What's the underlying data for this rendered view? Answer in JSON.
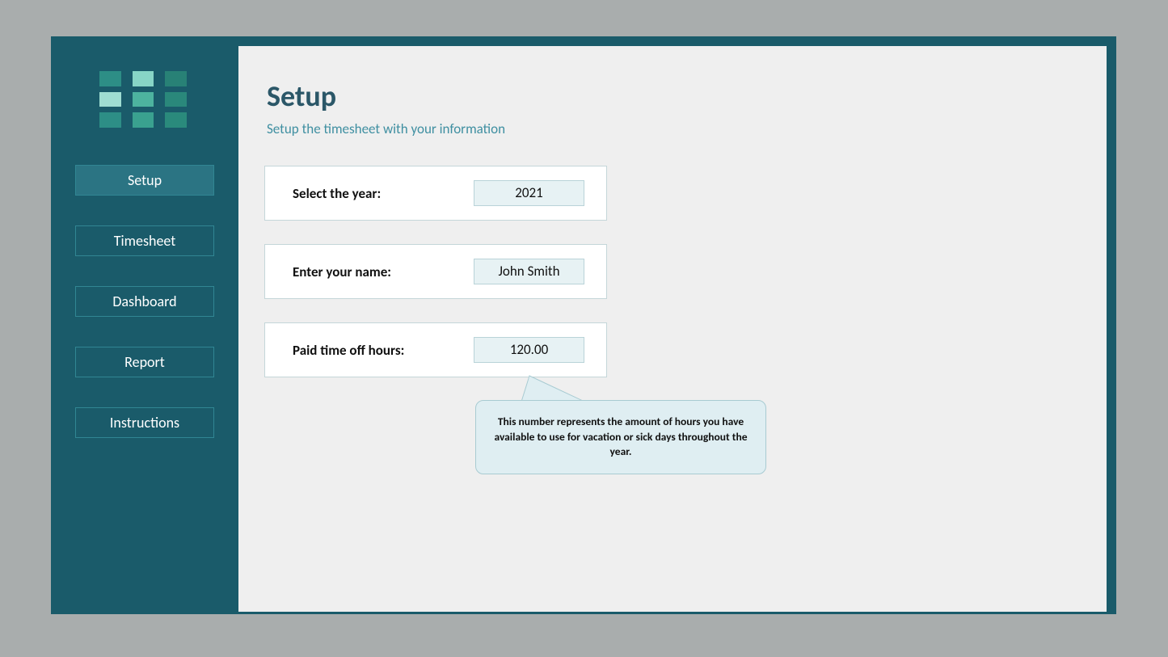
{
  "nav": {
    "items": [
      {
        "label": "Setup"
      },
      {
        "label": "Timesheet"
      },
      {
        "label": "Dashboard"
      },
      {
        "label": "Report"
      },
      {
        "label": "Instructions"
      }
    ]
  },
  "page": {
    "title": "Setup",
    "subtitle": "Setup the timesheet with your information"
  },
  "fields": {
    "year": {
      "label": "Select the year:",
      "value": "2021"
    },
    "name": {
      "label": "Enter your name:",
      "value": "John Smith"
    },
    "pto": {
      "label": "Paid time off hours:",
      "value": "120.00"
    }
  },
  "callout": {
    "text": "This number represents the amount of hours you have available to use for vacation or sick days throughout the year."
  },
  "logo_colors": [
    "#2d8e86",
    "#87d5c6",
    "#288176",
    "#9fddd2",
    "#4db39f",
    "#2a887b",
    "#2d8e86",
    "#3aa18f",
    "#2a8a7c"
  ]
}
